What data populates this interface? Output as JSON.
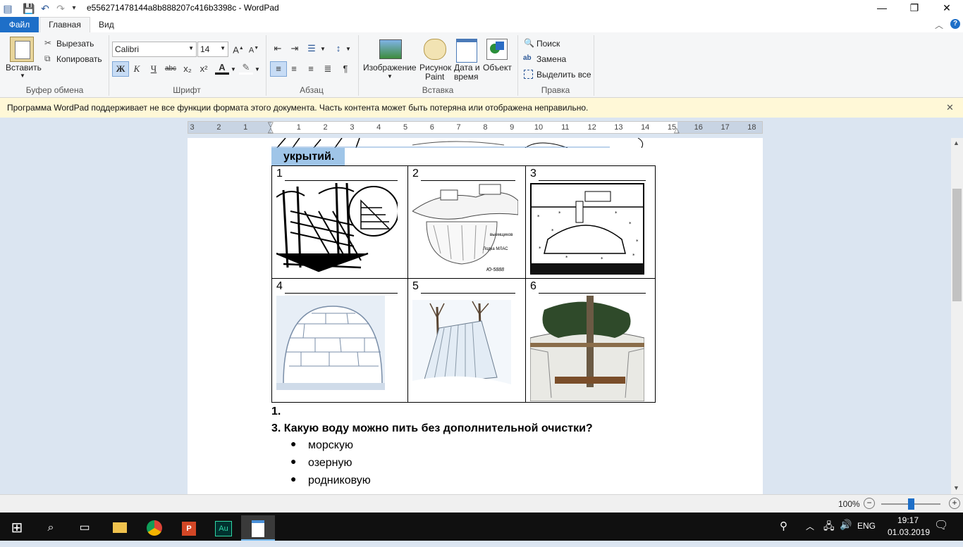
{
  "window": {
    "title": "e556271478144a8b888207c416b3398c - WordPad",
    "min": "—",
    "restore": "❐",
    "close": "✕"
  },
  "tabs": {
    "file": "Файл",
    "home": "Главная",
    "view": "Вид"
  },
  "ribbon": {
    "clipboard": {
      "paste": "Вставить",
      "cut": "Вырезать",
      "copy": "Копировать",
      "label": "Буфер обмена"
    },
    "font": {
      "family": "Calibri",
      "size": "14",
      "bold": "Ж",
      "italic": "К",
      "underline": "Ч",
      "strike": "abc",
      "sub": "x₂",
      "sup": "x²",
      "label": "Шрифт"
    },
    "paragraph": {
      "label": "Абзац"
    },
    "insert": {
      "image": "Изображение",
      "paint1": "Рисунок",
      "paint2": "Paint",
      "date1": "Дата и",
      "date2": "время",
      "object": "Объект",
      "label": "Вставка"
    },
    "edit": {
      "find": "Поиск",
      "replace": "Замена",
      "select_all": "Выделить все",
      "label": "Правка"
    }
  },
  "infobar": {
    "message": "Программа WordPad поддерживает не все функции формата этого документа. Часть контента может быть потеряна или отображена неправильно.",
    "close": "✕"
  },
  "ruler": {
    "labels": [
      "3",
      "2",
      "1",
      "1",
      "2",
      "3",
      "4",
      "5",
      "6",
      "7",
      "8",
      "9",
      "10",
      "11",
      "12",
      "13",
      "14",
      "15",
      "16",
      "17",
      "18"
    ]
  },
  "document": {
    "heading_tail": "укрытий.",
    "cells": [
      "1",
      "2",
      "3",
      "4",
      "5",
      "6"
    ],
    "item1": "1.",
    "question": "3.  Какую воду можно пить без дополнительной очистки?",
    "options": [
      "морскую",
      "озерную",
      "родниковую"
    ],
    "img_text": {
      "boat": "Лодка МЛАС",
      "code": "Ю-5888",
      "snow": "выемщиков"
    }
  },
  "status": {
    "zoom": "100%"
  },
  "taskbar": {
    "lang": "ENG",
    "time": "19:17",
    "date": "01.03.2019"
  },
  "colors": {
    "accent": "#1e6fc8",
    "heading_bg": "#9fc5e8",
    "infobar": "#fff8d7"
  }
}
